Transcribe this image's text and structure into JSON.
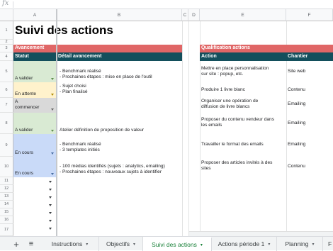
{
  "formula_bar": {
    "fx_icon": "fx-icon"
  },
  "columns": [
    "A",
    "B",
    "C",
    "D",
    "E",
    "F"
  ],
  "row_numbers": [
    "1",
    "2",
    "3",
    "4",
    "5",
    "6",
    "7",
    "8",
    "9",
    "10",
    "11",
    "12",
    "13",
    "14",
    "15",
    "16",
    "17"
  ],
  "title": "Suivi des actions",
  "avancement": {
    "section_label": "Avancement",
    "col_statut": "Statut",
    "col_detail": "Détail avancement",
    "rows": [
      {
        "statut": "A valider",
        "detail1": "- Benchmark réalisé",
        "detail2": "- Prochaines étapes : mise en place de l'outil",
        "color": "#d9ead3"
      },
      {
        "statut": "En attente",
        "detail1": "- Sujet choisi",
        "detail2": "- Plan finalisé",
        "color": "#fff2cc"
      },
      {
        "statut_line1": "A",
        "statut_line2": "commencer",
        "detail1": "",
        "detail2": "",
        "color": "#d9d9d9"
      },
      {
        "statut": "A valider",
        "detail1": "Atelier définition de proposition de valeur",
        "detail2": "",
        "color": "#d9ead3"
      },
      {
        "statut": "En cours",
        "detail1": "- Benchmark réalisé",
        "detail2": "- 3 templates initiés",
        "color": "#c9daf8"
      },
      {
        "statut": "En cours",
        "detail1": "- 100 médias identifiés (sujets : analytics, emailing)",
        "detail2": "- Prochaines étapes : nouveaux sujets à identifier",
        "color": "#c9daf8"
      }
    ]
  },
  "qualification": {
    "section_label": "Qualification actions",
    "col_action": "Action",
    "col_chantier": "Chantier",
    "rows": [
      {
        "action1": "Mettre en place personnalisation",
        "action2": "sur site : popup, etc.",
        "chantier": "Site web"
      },
      {
        "action1": "Produire 1 livre blanc",
        "action2": "",
        "chantier": "Contenu"
      },
      {
        "action1": "Organiser une opération de",
        "action2": "diffusion de livre blancs",
        "chantier": "Emailing"
      },
      {
        "action1": "Proposer du contenu vendeur dans",
        "action2": "les emails",
        "chantier": "Emailing"
      },
      {
        "action1": "Travailler le format des emails",
        "action2": "",
        "chantier": "Emailing"
      },
      {
        "action1": "Proposer des articles invités à des",
        "action2": "sites",
        "chantier": "Contenu"
      }
    ]
  },
  "tabs": {
    "add_label": "+",
    "menu_label": "≡",
    "items": [
      "Instructions",
      "Objectifs",
      "Suivi des actions",
      "Actions période 1",
      "Planning",
      "F"
    ],
    "active": "Suivi des actions",
    "caret": "▾"
  },
  "colors": {
    "red_header": "#e06666",
    "dark_header": "#134f5c",
    "active_tab": "#188038"
  }
}
